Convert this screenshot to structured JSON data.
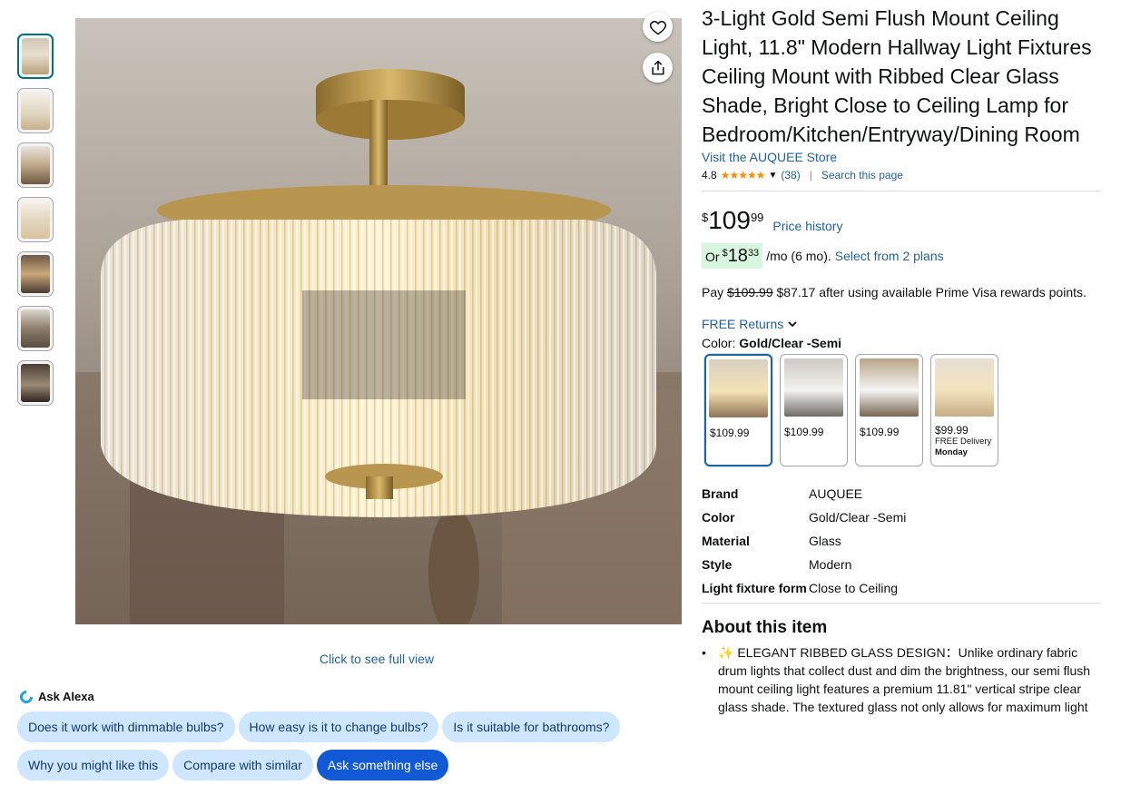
{
  "product": {
    "title": "3-Light Gold Semi Flush Mount Ceiling Light, 11.8\" Modern Hallway Light Fixtures Ceiling Mount with Ribbed Clear Glass Shade, Bright Close to Ceiling Lamp for Bedroom/Kitchen/Entryway/Dining Room",
    "store_link": "Visit the AUQUEE Store",
    "rating": "4.8",
    "stars_glyph": "★★★★★",
    "review_count": "(38)",
    "search_page": "Search this page"
  },
  "gallery": {
    "thumbnail_count": 7,
    "full_view_link": "Click to see full view",
    "icons": {
      "heart": "heart-icon",
      "share": "share-icon"
    }
  },
  "price": {
    "symbol": "$",
    "whole": "109",
    "fraction": "99",
    "history_link": "Price history"
  },
  "installment": {
    "or": "Or",
    "symbol": "$",
    "whole": "18",
    "fraction": "33",
    "per": "/mo (6 mo).",
    "plans_link": "Select from 2 plans"
  },
  "prime": {
    "pay": "Pay",
    "old_price": "$109.99",
    "new_text": "$87.17 after using available Prime Visa rewards points."
  },
  "returns": "FREE Returns",
  "color": {
    "label": "Color:",
    "selected": "Gold/Clear -Semi",
    "options": [
      {
        "price": "$109.99",
        "note1": "",
        "note2": ""
      },
      {
        "price": "$109.99",
        "note1": "",
        "note2": ""
      },
      {
        "price": "$109.99",
        "note1": "",
        "note2": ""
      },
      {
        "price": "$99.99",
        "note1": "FREE Delivery",
        "note2": "Monday"
      }
    ]
  },
  "specs": [
    {
      "k": "Brand",
      "v": "AUQUEE"
    },
    {
      "k": "Color",
      "v": "Gold/Clear -Semi"
    },
    {
      "k": "Material",
      "v": "Glass"
    },
    {
      "k": "Style",
      "v": "Modern"
    },
    {
      "k": "Light fixture form",
      "v": "Close to Ceiling"
    }
  ],
  "about": {
    "heading": "About this item",
    "bullet1_lead": "ELEGANT RIBBED GLASS DESIGN",
    "bullet1_text": "：Unlike ordinary fabric drum lights that collect dust and dim the brightness, our semi flush mount ceiling light features a premium 11.81\" vertical stripe clear glass shade. The textured glass not only allows for maximum light"
  },
  "alexa": {
    "label": "Ask Alexa",
    "chips_row1": [
      "Does it work with dimmable bulbs?",
      "How easy is it to change bulbs?",
      "Is it suitable for bathrooms?"
    ],
    "chips_row2": [
      "Why you might like this",
      "Compare with similar",
      "Ask something else"
    ]
  },
  "colors": {
    "link": "#2162a1",
    "price_pill": "#d8f5df",
    "chip": "#cfe6ff",
    "chip_primary": "#1259d6",
    "star": "#ff8b00"
  }
}
